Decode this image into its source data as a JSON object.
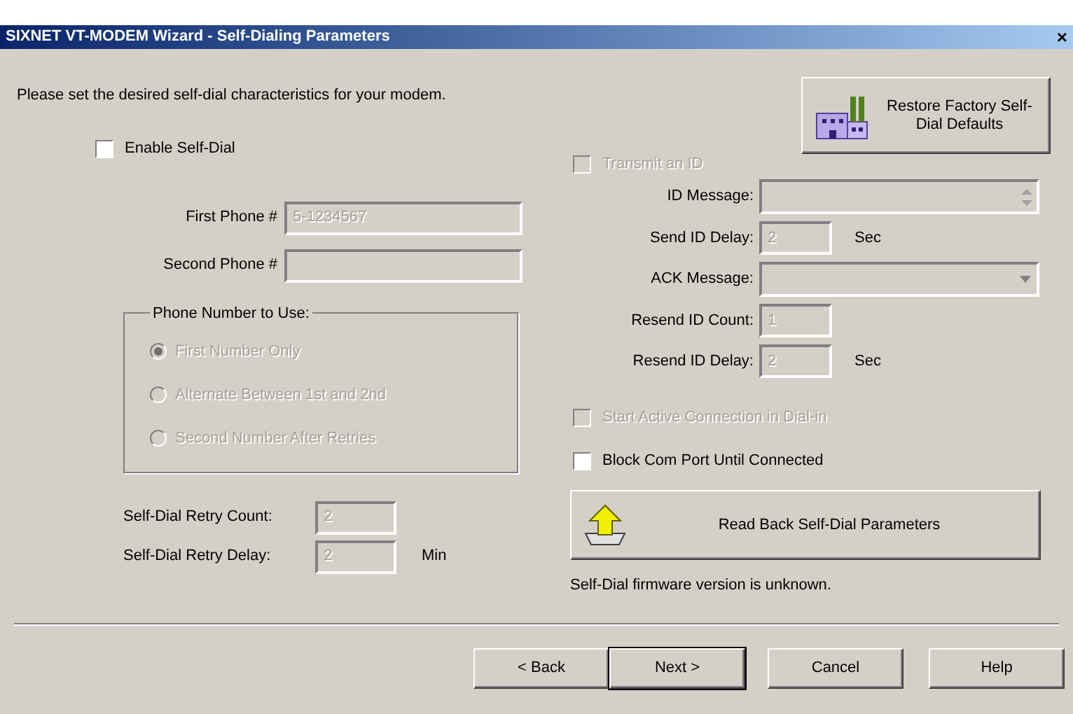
{
  "window": {
    "title": "SIXNET VT-MODEM Wizard - Self-Dialing Parameters",
    "close": "×"
  },
  "intro": "Please set the desired self-dial characteristics for your modem.",
  "restore_button": {
    "label": "Restore Factory Self-Dial Defaults"
  },
  "enable_self_dial": {
    "label": "Enable Self-Dial",
    "checked": false,
    "disabled": false
  },
  "phone_fields": [
    {
      "label": "First Phone #",
      "value": "5-1234567",
      "disabled": true
    },
    {
      "label": "Second Phone #",
      "disabled": true
    }
  ],
  "phone_number_group": {
    "title": "Phone Number to Use:",
    "options": [
      {
        "label": "First Number Only",
        "selected": true,
        "disabled": true
      },
      {
        "label": "Alternate Between 1st and 2nd",
        "selected": false,
        "disabled": true
      },
      {
        "label": "Second Number After Retries",
        "selected": false,
        "disabled": true
      }
    ]
  },
  "retry_fields": [
    {
      "label": "Self-Dial Retry Count:",
      "value": "2",
      "disabled": true
    },
    {
      "label": "Self-Dial Retry Delay:",
      "value": "2",
      "unit": "Min",
      "disabled": true
    }
  ],
  "transmit_id": {
    "label": "Transmit an ID",
    "checked": false,
    "disabled": true
  },
  "id_fields": [
    {
      "kind": "spin",
      "label": "ID Message:",
      "disabled": true
    },
    {
      "kind": "text",
      "label": "Send ID Delay:",
      "value": "2",
      "unit": "Sec",
      "disabled": true
    },
    {
      "kind": "combo",
      "label": "ACK Message:",
      "disabled": true
    },
    {
      "kind": "text",
      "label": "Resend ID Count:",
      "value": "1",
      "disabled": true
    },
    {
      "kind": "text",
      "label": "Resend ID Delay:",
      "value": "2",
      "unit": "Sec",
      "disabled": true
    }
  ],
  "options": [
    {
      "label": "Start Active Connection in Dial-in",
      "checked": false,
      "disabled": true
    },
    {
      "label": "Block Com Port Until Connected",
      "checked": false,
      "disabled": false
    }
  ],
  "read_back_button": {
    "label": "Read Back Self-Dial Parameters"
  },
  "firmware_status": "Self-Dial firmware version is unknown.",
  "buttons": [
    {
      "label": "< Back",
      "default": false
    },
    {
      "label": "Next >",
      "default": true
    },
    {
      "label": "Cancel",
      "default": false
    },
    {
      "label": "Help",
      "default": false
    }
  ]
}
